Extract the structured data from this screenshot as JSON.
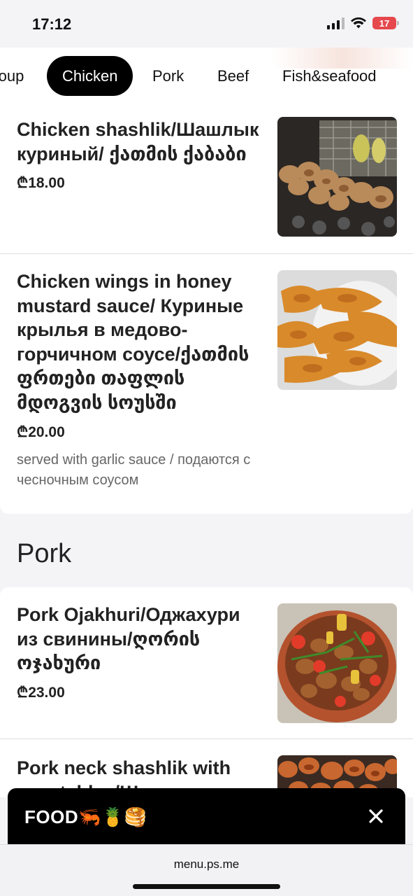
{
  "status_bar": {
    "time": "17:12",
    "battery": "17"
  },
  "tabs": [
    {
      "label": "Soup",
      "active": false
    },
    {
      "label": "Chicken",
      "active": true
    },
    {
      "label": "Pork",
      "active": false
    },
    {
      "label": "Beef",
      "active": false
    },
    {
      "label": "Fish&seafood",
      "active": false
    }
  ],
  "items": [
    {
      "title": "Chicken shashlik/Шашлык куриный/ ქათმის ქაბაბი",
      "price": "₾18.00",
      "photo": "chicken-skewers"
    },
    {
      "title": "Chicken wings in honey mustard sauce/ Куриные крылья в медово-горчичном соусе/ქათმის ფრთები თაფლის მდოგვის სოუსში",
      "price": "₾20.00",
      "description": "served with garlic sauce / подаются с чесночным соусом",
      "photo": "chicken-wings"
    },
    {
      "title": "Pork Ojakhuri/Оджахури из свинины/ღორის ოჯახური",
      "price": "₾23.00",
      "photo": "pork-ojakhuri"
    },
    {
      "title": "Pork neck shashlik with vegetables/Ш",
      "photo": "pork-shashlik"
    }
  ],
  "sections": {
    "pork": "Pork"
  },
  "cart_bar": {
    "label": "FOOD🦐🍍🥞"
  },
  "browser": {
    "url": "menu.ps.me"
  }
}
